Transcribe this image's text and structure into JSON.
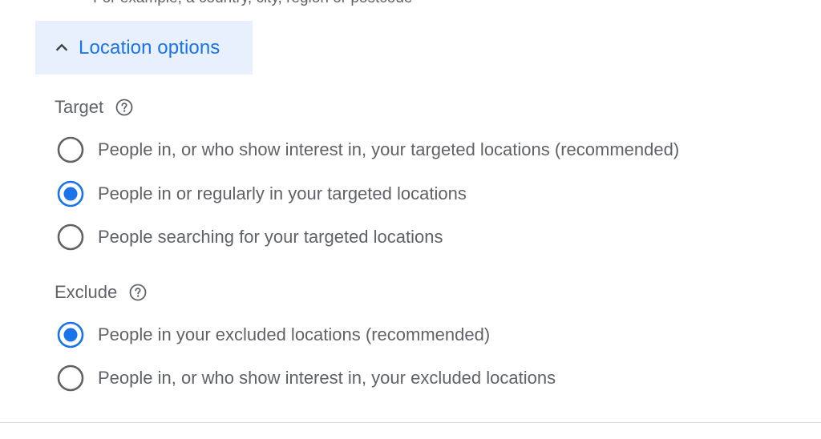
{
  "hint_text": "For example, a country, city, region or postcode",
  "location_options": {
    "toggle_label": "Location options",
    "expanded": true
  },
  "target": {
    "title": "Target",
    "options": [
      {
        "label": "People in, or who show interest in, your targeted locations (recommended)",
        "selected": false
      },
      {
        "label": "People in or regularly in your targeted locations",
        "selected": true
      },
      {
        "label": "People searching for your targeted locations",
        "selected": false
      }
    ]
  },
  "exclude": {
    "title": "Exclude",
    "options": [
      {
        "label": "People in your excluded locations (recommended)",
        "selected": true
      },
      {
        "label": "People in, or who show interest in, your excluded locations",
        "selected": false
      }
    ]
  },
  "colors": {
    "accent": "#1a73e8",
    "expander_bg": "#e8f0fe",
    "text": "#5f6368",
    "radio_border": "#5f6368",
    "divider": "#dadce0"
  }
}
